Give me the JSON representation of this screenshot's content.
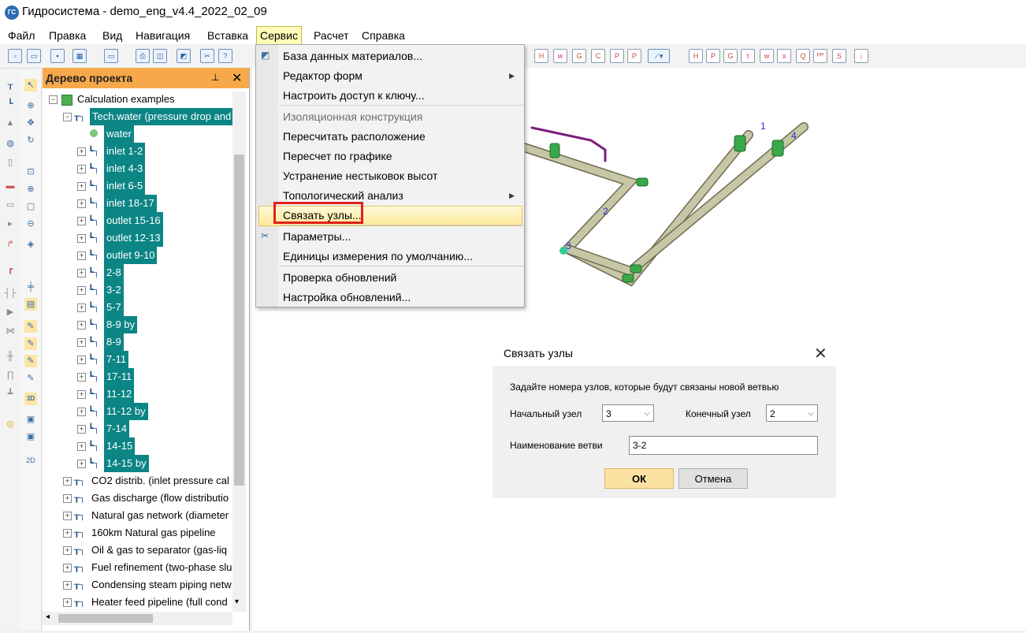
{
  "window": {
    "title": "Гидросистема - demo_eng_v4.4_2022_02_09",
    "app_icon_text": "ГС"
  },
  "menubar": {
    "items": [
      "Файл",
      "Правка",
      "Вид",
      "Навигация",
      "Вставка",
      "Сервис",
      "Расчет",
      "Справка"
    ],
    "active": "Сервис"
  },
  "toolbar": {
    "right_buttons": [
      "H",
      "w",
      "G",
      "C",
      "P",
      "P",
      "H",
      "P",
      "G",
      "t",
      "w",
      "x",
      "Q",
      "FP",
      "S"
    ]
  },
  "panel": {
    "title": "Дерево проекта",
    "pin_icon": "pin-icon",
    "close_label": "✕",
    "root": "Calculation examples",
    "selected_project": "Tech.water (pressure drop and",
    "water": "water",
    "branches": [
      "inlet 1-2",
      "inlet 4-3",
      "inlet 6-5",
      "inlet 18-17",
      "outlet 15-16",
      "outlet 12-13",
      "outlet 9-10",
      "2-8",
      "3-2",
      "5-7",
      "8-9 by",
      "8-9",
      "7-11",
      "17-11",
      "11-12",
      "11-12 by",
      "7-14",
      "14-15",
      "14-15 by"
    ],
    "projects": [
      "CO2 distrib. (inlet pressure cal",
      "Gas discharge (flow distributio",
      "Natural gas network (diameter",
      "160km Natural gas pipeline",
      "Oil & gas to separator (gas-liq",
      "Fuel refinement (two-phase slu",
      "Condensing steam piping netw",
      "Heater feed pipeline (full cond"
    ]
  },
  "context_menu": {
    "items": [
      {
        "label": "База данных материалов...",
        "disabled": false,
        "submenu": false,
        "icon": "database-icon"
      },
      {
        "label": "Редактор форм",
        "disabled": false,
        "submenu": true
      },
      {
        "label": "Настроить доступ к ключу...",
        "disabled": false,
        "submenu": false
      },
      {
        "label": "Изоляционная конструкция",
        "disabled": true,
        "submenu": false
      },
      {
        "label": "Пересчитать расположение",
        "disabled": false,
        "submenu": false
      },
      {
        "label": "Пересчет по графике",
        "disabled": false,
        "submenu": false
      },
      {
        "label": "Устранение нестыковок высот",
        "disabled": false,
        "submenu": false
      },
      {
        "label": "Топологический анализ",
        "disabled": false,
        "submenu": true
      },
      {
        "label": "Связать узлы...",
        "disabled": false,
        "submenu": false,
        "highlighted": true
      },
      {
        "label": "Параметры...",
        "disabled": false,
        "submenu": false,
        "icon": "tools-icon"
      },
      {
        "label": "Единицы измерения по умолчанию...",
        "disabled": false,
        "submenu": false
      },
      {
        "label": "Проверка обновлений",
        "disabled": false,
        "submenu": false
      },
      {
        "label": "Настройка обновлений...",
        "disabled": false,
        "submenu": false
      }
    ]
  },
  "canvas": {
    "node_labels": [
      "1",
      "4",
      "2",
      "3"
    ]
  },
  "dialog": {
    "title": "Связать узлы",
    "close_label": "✕",
    "prompt": "Задайте номера узлов, которые будут связаны новой ветвью",
    "start_node_label": "Начальный узел",
    "start_node_value": "3",
    "end_node_label": "Конечный узел",
    "end_node_value": "2",
    "branch_name_label": "Наименование ветви",
    "branch_name_value": "3-2",
    "ok_label": "ОК",
    "cancel_label": "Отмена"
  }
}
